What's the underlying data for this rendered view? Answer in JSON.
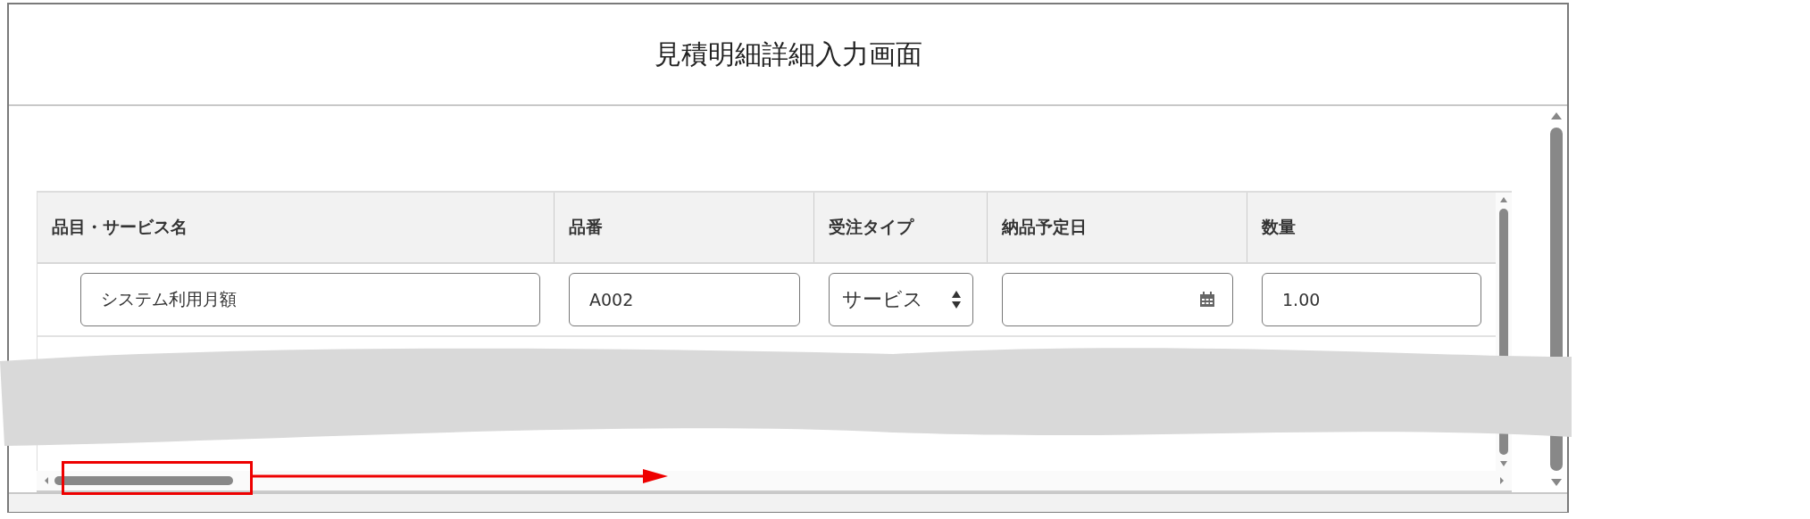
{
  "window": {
    "title": "見積明細詳細入力画面"
  },
  "table": {
    "columns": [
      "品目・サービス名",
      "品番",
      "受注タイプ",
      "納品予定日",
      "数量"
    ],
    "rows": [
      {
        "cells": [
          {
            "kind": "text",
            "value": "システム利用月額"
          },
          {
            "kind": "text",
            "value": "A002"
          },
          {
            "kind": "select",
            "value": "サービス"
          },
          {
            "kind": "date"
          },
          {
            "kind": "text",
            "value": "1.00"
          }
        ]
      }
    ]
  }
}
